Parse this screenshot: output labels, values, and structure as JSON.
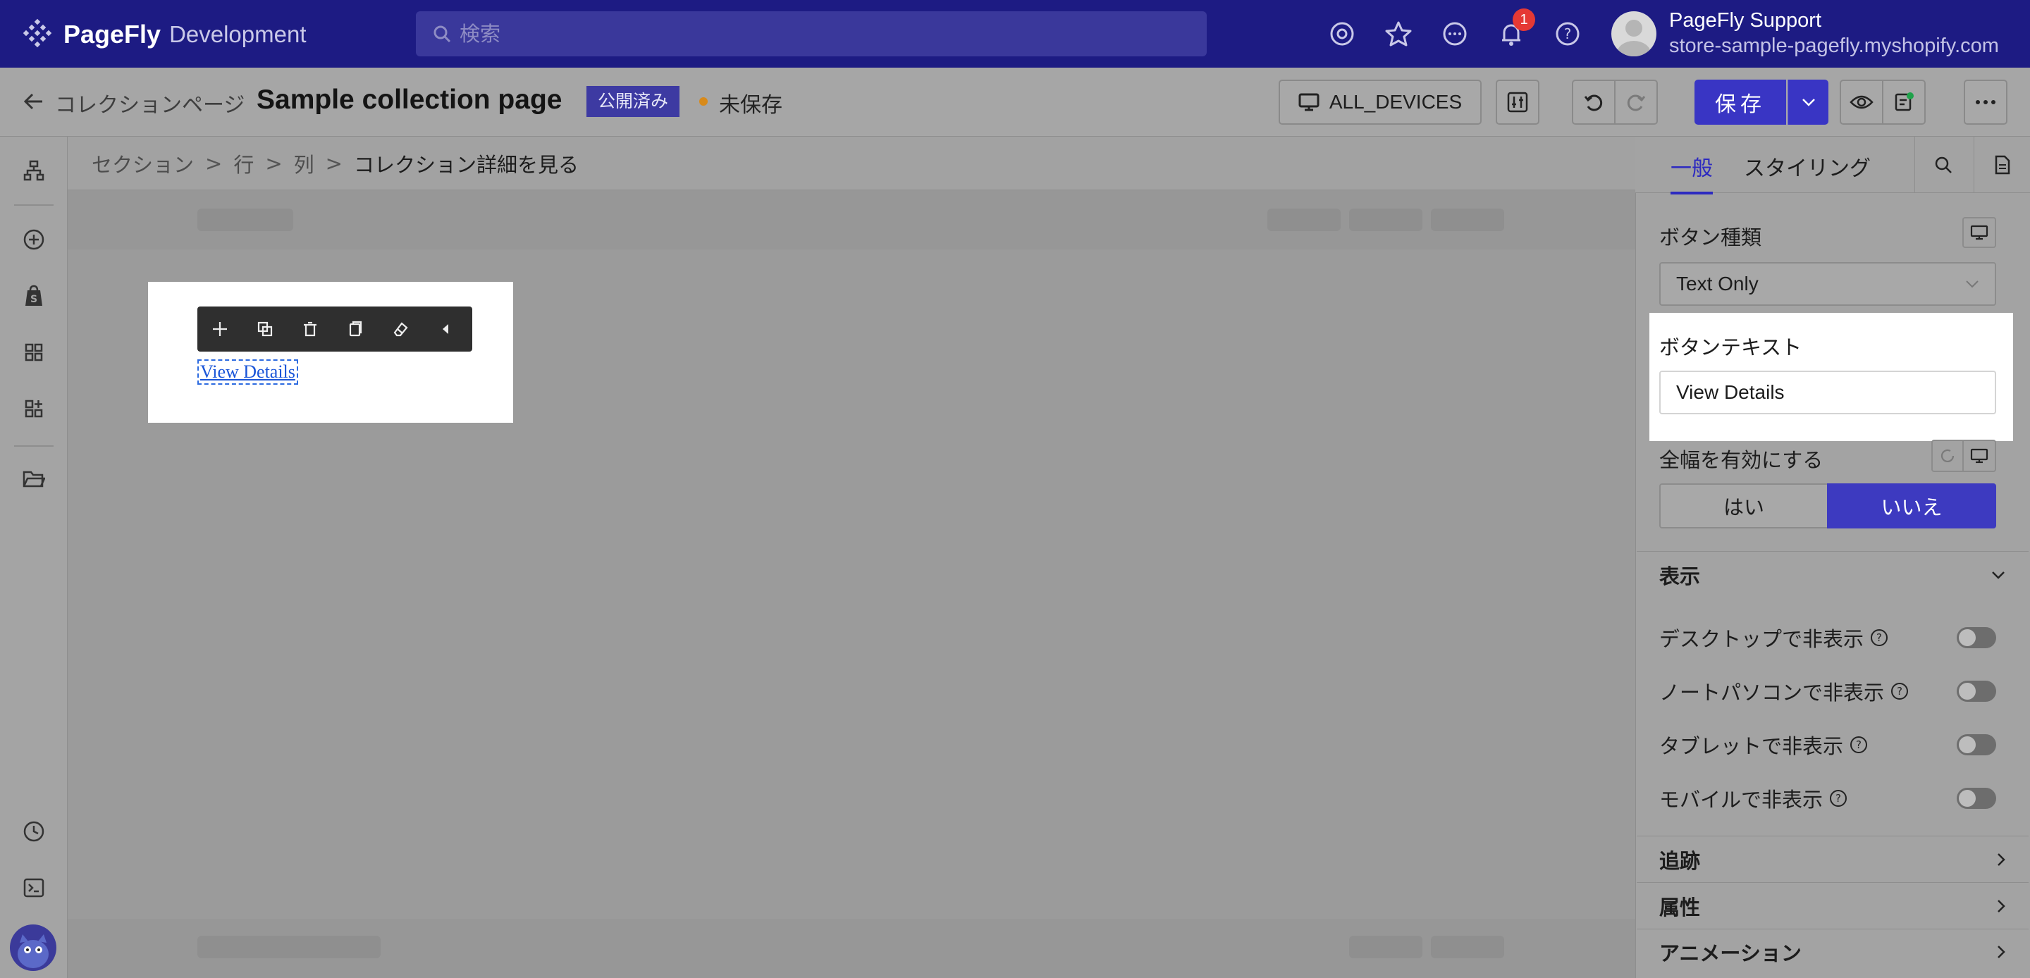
{
  "app": {
    "brand": "PageFly",
    "env": "Development"
  },
  "search": {
    "placeholder": "検索"
  },
  "notifications": {
    "count": "1"
  },
  "user": {
    "name": "PageFly Support",
    "store": "store-sample-pagefly.myshopify.com"
  },
  "header": {
    "back_label": "コレクションページ",
    "title": "Sample collection page",
    "status": "公開済み",
    "unsaved": "未保存",
    "devices": "ALL_DEVICES",
    "save": "保存"
  },
  "breadcrumb": [
    "セクション",
    "行",
    "列",
    "コレクション詳細を見る"
  ],
  "canvas": {
    "link_text": "View Details"
  },
  "panel": {
    "tabs": {
      "general": "一般",
      "styling": "スタイリング"
    },
    "button_type_label": "ボタン種類",
    "button_type_value": "Text Only",
    "button_text_label": "ボタンテキスト",
    "button_text_value": "View Details",
    "full_width_label": "全幅を有効にする",
    "yes": "はい",
    "no": "いいえ",
    "display_section": "表示",
    "toggles": [
      "デスクトップで非表示",
      "ノートパソコンで非表示",
      "タブレットで非表示",
      "モバイルで非表示"
    ],
    "tracking_section": "追跡",
    "attributes_section": "属性",
    "animation_section": "アニメーション"
  },
  "colors": {
    "brand_nav": "#1d1b83",
    "primary": "#3935c4",
    "badge": "#e53935"
  }
}
